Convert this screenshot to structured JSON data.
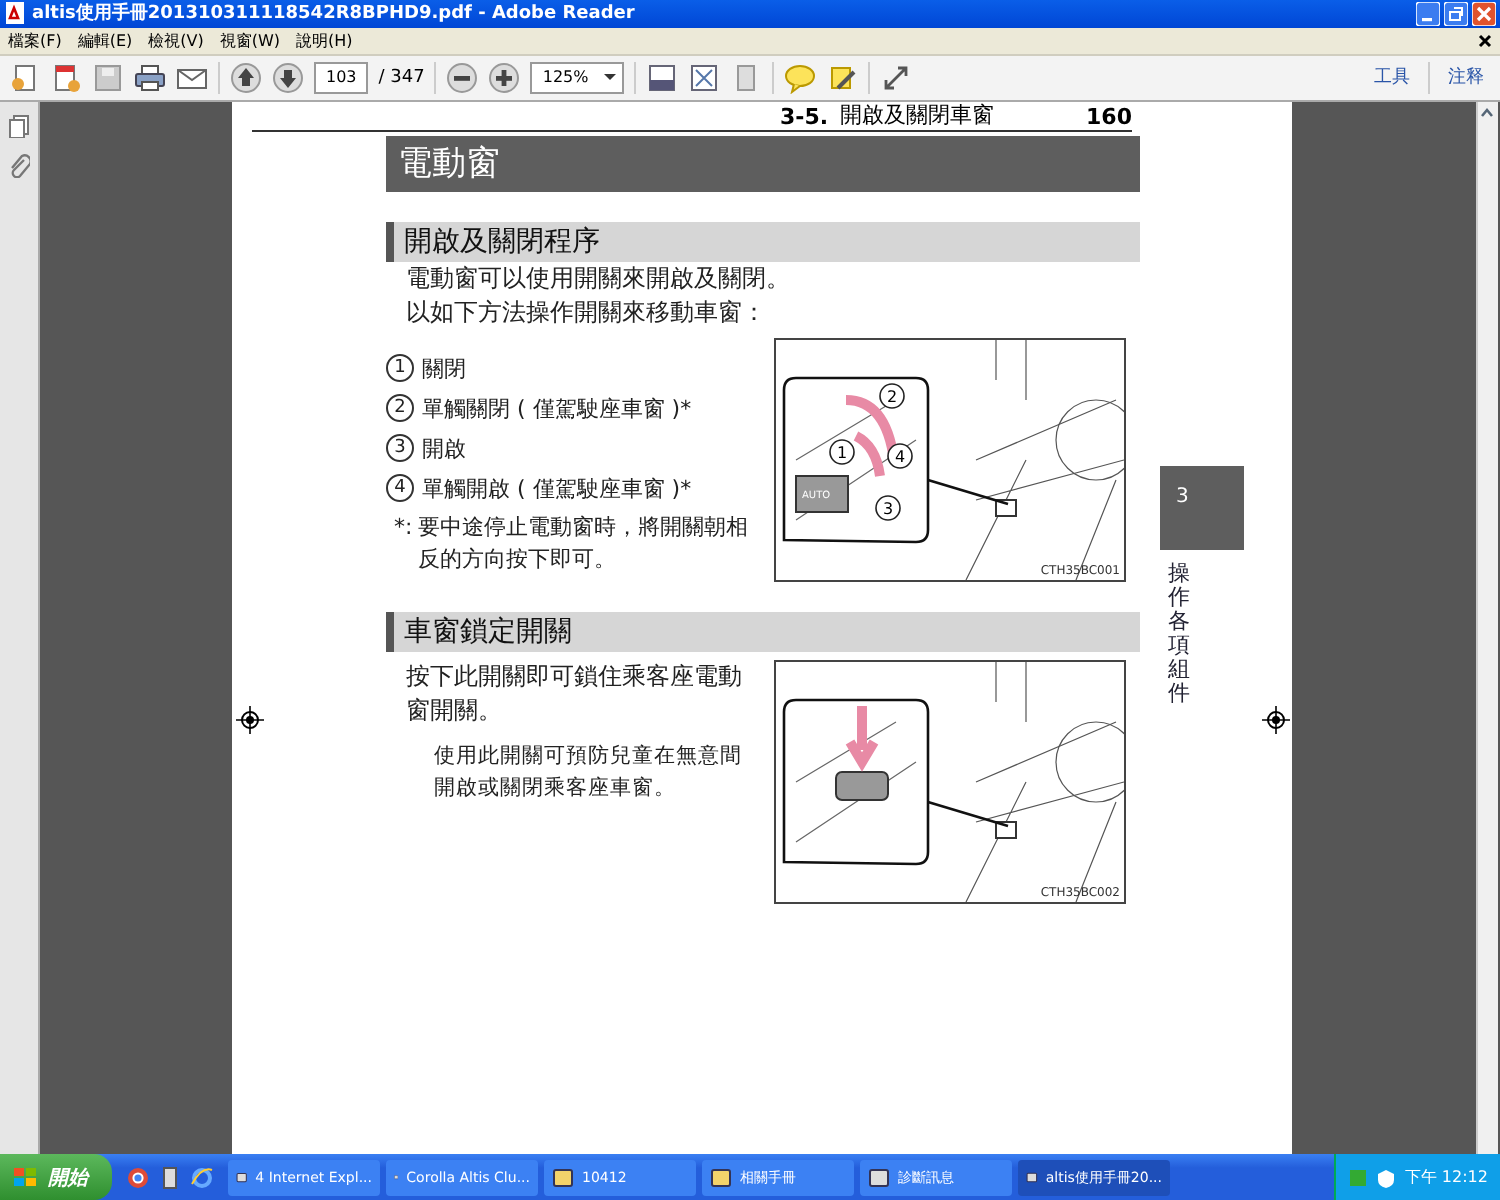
{
  "window": {
    "title": "altis使用手冊201310311118542R8BPHD9.pdf - Adobe Reader"
  },
  "menu": [
    {
      "label": "檔案(F)"
    },
    {
      "label": "編輯(E)"
    },
    {
      "label": "檢視(V)"
    },
    {
      "label": "視窗(W)"
    },
    {
      "label": "說明(H)"
    }
  ],
  "toolbar": {
    "page": "103",
    "page_total": "/ 347",
    "zoom": "125%",
    "right_buttons": [
      "工具",
      "注释"
    ]
  },
  "document": {
    "running_header": {
      "section": "3-5.",
      "title": "開啟及關閉車窗",
      "page": "160"
    },
    "heading": "電動窗",
    "sections": [
      {
        "title": "開啟及關閉程序",
        "paragraphs": [
          "電動窗可以使用開關來開啟及關閉。",
          "以如下方法操作開關來移動車窗："
        ],
        "steps": [
          {
            "number": "1",
            "text": "關閉"
          },
          {
            "number": "2",
            "text": "單觸關閉 ( 僅駕駛座車窗 )*"
          },
          {
            "number": "3",
            "text": "開啟"
          },
          {
            "number": "4",
            "text": "單觸開啟 ( 僅駕駛座車窗 )*"
          }
        ],
        "note": {
          "marker": "*:",
          "text": "要中途停止電動窗時，將開關朝相反的方向按下即可。"
        },
        "figure": {
          "kind": "auto",
          "callouts": [
            "2",
            "1",
            "4",
            "3"
          ],
          "switch_label": "AUTO",
          "code": "CTH35BC001"
        }
      },
      {
        "title": "車窗鎖定開關",
        "paragraphs": [
          "按下此開關即可鎖住乘客座電動窗開關。"
        ],
        "sub_note": "使用此開關可預防兒童在無意間開啟或關閉乘客座車窗。",
        "figure": {
          "kind": "lock",
          "code": "CTH35BC002"
        }
      }
    ],
    "side_tab": {
      "number": "3",
      "label": "操作各項組件"
    }
  },
  "taskbar": {
    "start": "開始",
    "tasks": [
      {
        "label": "4 Internet Expl...",
        "selected": false
      },
      {
        "label": "Corolla Altis Clu...",
        "selected": false
      },
      {
        "label": "10412",
        "selected": false
      },
      {
        "label": "相關手冊",
        "selected": false
      },
      {
        "label": "診斷訊息",
        "selected": false
      },
      {
        "label": "altis使用手冊20...",
        "selected": true
      }
    ],
    "clock": "下午 12:12"
  }
}
